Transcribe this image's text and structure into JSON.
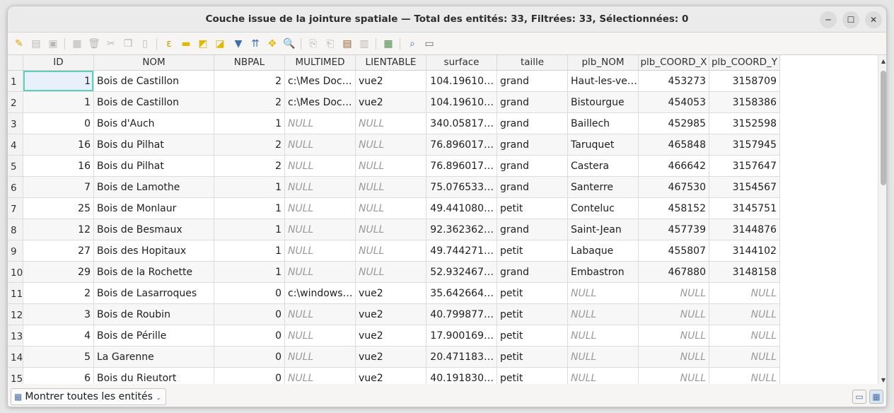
{
  "window": {
    "title": "Couche issue de la jointure spatiale — Total des entités: 33, Filtrées: 33, Sélectionnées: 0"
  },
  "table": {
    "columns": [
      "ID",
      "NOM",
      "NBPAL",
      "MULTIMED",
      "LIENTABLE",
      "surface",
      "taille",
      "plb_NOM",
      "plb_COORD_X",
      "plb_COORD_Y"
    ],
    "rows": [
      {
        "n": "1",
        "ID": "1",
        "NOM": "Bois de Castillon",
        "NBPAL": "2",
        "MULTIMED": "c:\\Mes Doc…",
        "LIENTABLE": "vue2",
        "surface": "104.19610…",
        "taille": "grand",
        "plb_NOM": "Haut-les-ve…",
        "plb_COORD_X": "453273",
        "plb_COORD_Y": "3158709"
      },
      {
        "n": "2",
        "ID": "1",
        "NOM": "Bois de Castillon",
        "NBPAL": "2",
        "MULTIMED": "c:\\Mes Doc…",
        "LIENTABLE": "vue2",
        "surface": "104.19610…",
        "taille": "grand",
        "plb_NOM": "Bistourgue",
        "plb_COORD_X": "454053",
        "plb_COORD_Y": "3158386"
      },
      {
        "n": "3",
        "ID": "0",
        "NOM": "Bois d'Auch",
        "NBPAL": "1",
        "MULTIMED": "NULL",
        "LIENTABLE": "NULL",
        "surface": "340.05817…",
        "taille": "grand",
        "plb_NOM": "Baillech",
        "plb_COORD_X": "452985",
        "plb_COORD_Y": "3152598"
      },
      {
        "n": "4",
        "ID": "16",
        "NOM": "Bois du Pilhat",
        "NBPAL": "2",
        "MULTIMED": "NULL",
        "LIENTABLE": "NULL",
        "surface": "76.896017…",
        "taille": "grand",
        "plb_NOM": "Taruquet",
        "plb_COORD_X": "465848",
        "plb_COORD_Y": "3157945"
      },
      {
        "n": "5",
        "ID": "16",
        "NOM": "Bois du Pilhat",
        "NBPAL": "2",
        "MULTIMED": "NULL",
        "LIENTABLE": "NULL",
        "surface": "76.896017…",
        "taille": "grand",
        "plb_NOM": "Castera",
        "plb_COORD_X": "466642",
        "plb_COORD_Y": "3157647"
      },
      {
        "n": "6",
        "ID": "7",
        "NOM": "Bois de Lamothe",
        "NBPAL": "1",
        "MULTIMED": "NULL",
        "LIENTABLE": "NULL",
        "surface": "75.076533…",
        "taille": "grand",
        "plb_NOM": "Santerre",
        "plb_COORD_X": "467530",
        "plb_COORD_Y": "3154567"
      },
      {
        "n": "7",
        "ID": "25",
        "NOM": "Bois de Monlaur",
        "NBPAL": "1",
        "MULTIMED": "NULL",
        "LIENTABLE": "NULL",
        "surface": "49.441080…",
        "taille": "petit",
        "plb_NOM": "Conteluc",
        "plb_COORD_X": "458152",
        "plb_COORD_Y": "3145751"
      },
      {
        "n": "8",
        "ID": "12",
        "NOM": "Bois de Besmaux",
        "NBPAL": "1",
        "MULTIMED": "NULL",
        "LIENTABLE": "NULL",
        "surface": "92.362362…",
        "taille": "grand",
        "plb_NOM": "Saint-Jean",
        "plb_COORD_X": "457739",
        "plb_COORD_Y": "3144876"
      },
      {
        "n": "9",
        "ID": "27",
        "NOM": "Bois des Hopitaux",
        "NBPAL": "1",
        "MULTIMED": "NULL",
        "LIENTABLE": "NULL",
        "surface": "49.744271…",
        "taille": "petit",
        "plb_NOM": "Labaque",
        "plb_COORD_X": "455807",
        "plb_COORD_Y": "3144102"
      },
      {
        "n": "10",
        "ID": "29",
        "NOM": "Bois de la Rochette",
        "NBPAL": "1",
        "MULTIMED": "NULL",
        "LIENTABLE": "NULL",
        "surface": "52.932467…",
        "taille": "grand",
        "plb_NOM": "Embastron",
        "plb_COORD_X": "467880",
        "plb_COORD_Y": "3148158"
      },
      {
        "n": "11",
        "ID": "2",
        "NOM": "Bois de Lasarroques",
        "NBPAL": "0",
        "MULTIMED": "c:\\windows…",
        "LIENTABLE": "vue2",
        "surface": "35.642664…",
        "taille": "petit",
        "plb_NOM": "NULL",
        "plb_COORD_X": "NULL",
        "plb_COORD_Y": "NULL"
      },
      {
        "n": "12",
        "ID": "3",
        "NOM": "Bois de Roubin",
        "NBPAL": "0",
        "MULTIMED": "NULL",
        "LIENTABLE": "vue2",
        "surface": "40.799877…",
        "taille": "petit",
        "plb_NOM": "NULL",
        "plb_COORD_X": "NULL",
        "plb_COORD_Y": "NULL"
      },
      {
        "n": "13",
        "ID": "4",
        "NOM": "Bois de Pérille",
        "NBPAL": "0",
        "MULTIMED": "NULL",
        "LIENTABLE": "vue2",
        "surface": "17.900169…",
        "taille": "petit",
        "plb_NOM": "NULL",
        "plb_COORD_X": "NULL",
        "plb_COORD_Y": "NULL"
      },
      {
        "n": "14",
        "ID": "5",
        "NOM": "La Garenne",
        "NBPAL": "0",
        "MULTIMED": "NULL",
        "LIENTABLE": "vue2",
        "surface": "20.471183…",
        "taille": "petit",
        "plb_NOM": "NULL",
        "plb_COORD_X": "NULL",
        "plb_COORD_Y": "NULL"
      },
      {
        "n": "15",
        "ID": "6",
        "NOM": "Bois du Rieutort",
        "NBPAL": "0",
        "MULTIMED": "NULL",
        "LIENTABLE": "vue2",
        "surface": "40.191830…",
        "taille": "petit",
        "plb_NOM": "NULL",
        "plb_COORD_X": "NULL",
        "plb_COORD_Y": "NULL"
      }
    ]
  },
  "statusbar": {
    "filter_label": "Montrer toutes les entités"
  }
}
